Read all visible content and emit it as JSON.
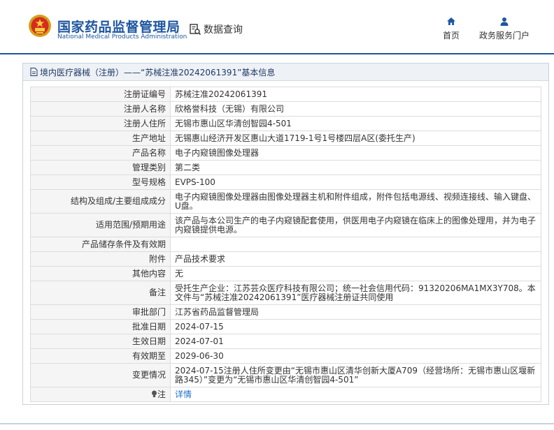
{
  "header": {
    "logo_cn": "国家药品监督管理局",
    "logo_en": "National Medical Products Administration",
    "data_query": "数据查询",
    "nav": [
      {
        "label": "首页",
        "icon": "home-icon"
      },
      {
        "label": "政务服务门户",
        "icon": "user-icon"
      }
    ]
  },
  "panel": {
    "title": "境内医疗器械（注册）——“苏械注准20242061391”基本信息",
    "rows": [
      {
        "label": "注册证编号",
        "value": "苏械注准20242061391"
      },
      {
        "label": "注册人名称",
        "value": "欣格誉科技（无锡）有限公司"
      },
      {
        "label": "注册人住所",
        "value": "无锡市惠山区华清创智园4-501"
      },
      {
        "label": "生产地址",
        "value": "无锡惠山经济开发区惠山大道1719-1号1号楼四层A区(委托生产)"
      },
      {
        "label": "产品名称",
        "value": "电子内窥镜图像处理器"
      },
      {
        "label": "管理类别",
        "value": "第二类"
      },
      {
        "label": "型号规格",
        "value": "EVPS-100"
      },
      {
        "label": "结构及组成/主要组成成分",
        "value": "电子内窥镜图像处理器由图像处理器主机和附件组成，附件包括电源线、视频连接线、输入键盘、U盘。"
      },
      {
        "label": "适用范围/预期用途",
        "value": "该产品与本公司生产的电子内窥镜配套使用，供医用电子内窥镜在临床上的图像处理用，并为电子内窥镜提供电源。"
      },
      {
        "label": "产品储存条件及有效期",
        "value": ""
      },
      {
        "label": "附件",
        "value": "产品技术要求"
      },
      {
        "label": "其他内容",
        "value": "无"
      },
      {
        "label": "备注",
        "value": "受托生产企业：江苏芸众医疗科技有限公司；统一社会信用代码：91320206MA1MX3Y708。本文件与“苏械注准20242061391”医疗器械注册证共同使用"
      },
      {
        "label": "审批部门",
        "value": "江苏省药品监督管理局"
      },
      {
        "label": "批准日期",
        "value": "2024-07-15"
      },
      {
        "label": "生效日期",
        "value": "2024-07-01"
      },
      {
        "label": "有效期至",
        "value": "2029-06-30"
      },
      {
        "label": "变更情况",
        "value": "2024-07-15注册人住所变更由“无锡市惠山区清华创新大厦A709（经营场所：无锡市惠山区堰新路345）”变更为“无锡市惠山区华清创智园4-501”"
      },
      {
        "label": "注",
        "value": "详情",
        "icon": "lightbulb-icon"
      }
    ]
  }
}
